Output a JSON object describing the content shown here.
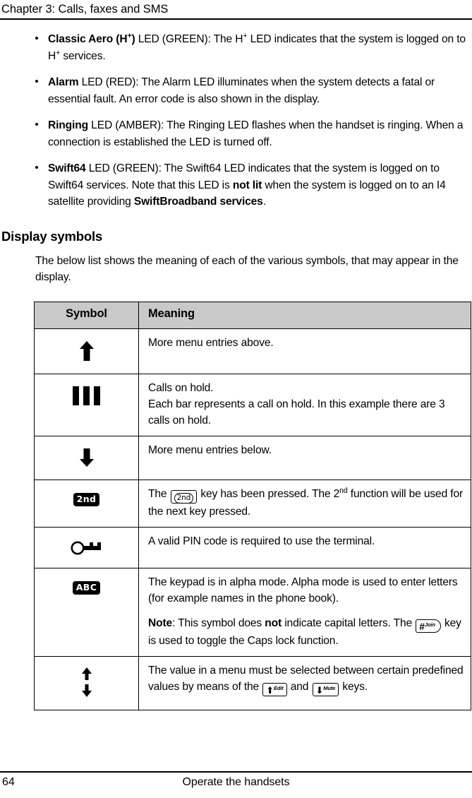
{
  "header": {
    "chapter_title": "Chapter 3:  Calls, faxes and SMS"
  },
  "bullets": [
    {
      "id": "classic-aero",
      "term": "Classic Aero (H+)",
      "text": " LED (GREEN): The H+ LED indicates that the system is logged on to H+ services."
    },
    {
      "id": "alarm",
      "term": "Alarm",
      "text": " LED (RED): The Alarm LED illuminates when the system detects a fatal or essential fault. An error code is also shown in the display."
    },
    {
      "id": "ringing",
      "term": "Ringing",
      "text": " LED (AMBER): The Ringing LED flashes when the handset is ringing. When a connection is established the LED is turned off."
    },
    {
      "id": "swift64",
      "term": "Swift64",
      "text": " LED (GREEN): The Swift64 LED indicates that the system is logged on to Swift64 services. Note that this LED is not lit when the system is logged on to an I4 satellite providing SwiftBroadband services."
    }
  ],
  "section": {
    "heading": "Display symbols",
    "intro": "The below list shows the meaning of each of the various symbols, that may appear in the display."
  },
  "table": {
    "columns": [
      "Symbol",
      "Meaning"
    ],
    "rows": [
      {
        "symbol_icon": "arrow-up-icon",
        "symbol_text": "",
        "meaning_lines": [
          "More menu entries above."
        ]
      },
      {
        "symbol_icon": "three-bars-icon",
        "symbol_text": "",
        "meaning_lines": [
          "Calls on hold.",
          "Each bar represents a call on hold. In this example there are 3 calls on hold."
        ]
      },
      {
        "symbol_icon": "arrow-down-icon",
        "symbol_text": "",
        "meaning_lines": [
          "More menu entries below."
        ]
      },
      {
        "symbol_icon": "second-function-chip-icon",
        "symbol_text": "2nd",
        "meaning_lines": [
          "The 2nd key has been pressed. The 2nd function will be used for the next key pressed."
        ]
      },
      {
        "symbol_icon": "key-icon",
        "symbol_text": "",
        "meaning_lines": [
          "A valid PIN code is required to use the terminal."
        ]
      },
      {
        "symbol_icon": "alpha-mode-chip-icon",
        "symbol_text": "ABC",
        "meaning_lines": [
          "The keypad is in alpha mode. Alpha mode is used to enter letters (for example names in the phone book).",
          "Note: This symbol does not indicate capital letters. The # Join key is used to toggle the Caps lock function."
        ]
      },
      {
        "symbol_icon": "arrow-up-down-icon",
        "symbol_text": "",
        "meaning_lines": [
          "The value in a menu must be selected between certain predefined values by means of the Edit and Mute keys."
        ]
      }
    ]
  },
  "keycaps": {
    "second": "2nd",
    "hash": "#",
    "hash_label": "Join",
    "up_label": "Edit",
    "down_label": "Mute"
  },
  "footer": {
    "page_number": "64",
    "section_title": "Operate the handsets"
  },
  "colors": {
    "text": "#000000",
    "table_header_bg": "#c9c9c9",
    "rule": "#000000"
  }
}
